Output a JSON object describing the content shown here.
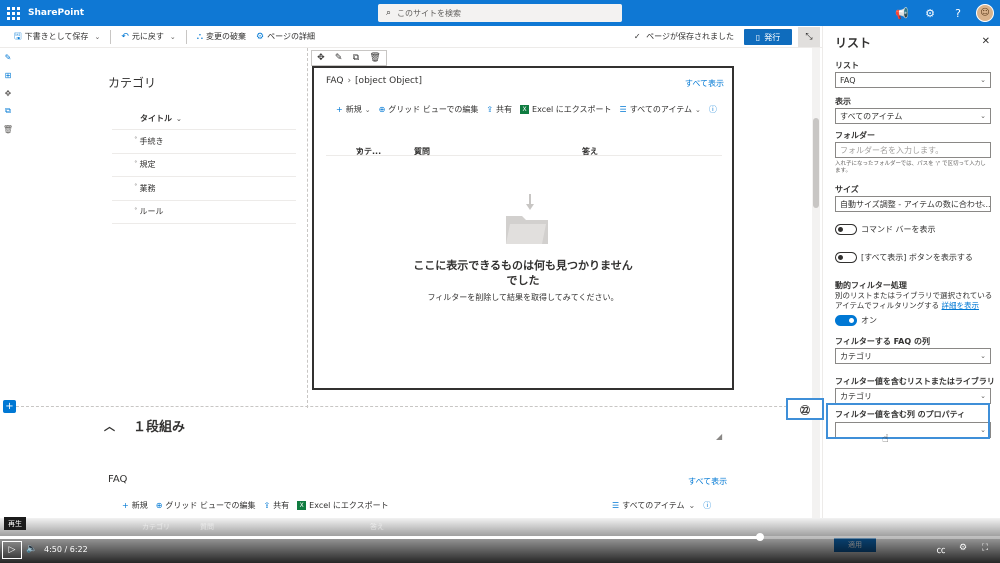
{
  "suite": {
    "brand": "SharePoint",
    "search_placeholder": "このサイトを検索",
    "avatar_initial": "☺"
  },
  "commandbar": {
    "save_draft": "下書きとして保存",
    "undo": "元に戻す",
    "discard": "変更の破棄",
    "page_details": "ページの詳細",
    "saved_status": "ページが保存されました",
    "publish": "発行"
  },
  "category_webpart": {
    "title": "カテゴリ",
    "column_header": "タイトル",
    "rows": [
      "手続き",
      "規定",
      "業務",
      "ルール"
    ]
  },
  "faq_webpart": {
    "list_name": "FAQ",
    "view_name": "[object Object]",
    "show_all": "すべて表示",
    "commands": {
      "new": "新規",
      "grid_edit": "グリッド ビューでの編集",
      "share": "共有",
      "export": "Excel にエクスポート",
      "all_items": "すべてのアイテム"
    },
    "columns": {
      "category": "カテ...",
      "question": "質問",
      "answer": "答え"
    },
    "empty_title": "ここに表示できるものは何も見つかりません\nでした",
    "empty_subtitle": "フィルターを削除して結果を取得してみてください。"
  },
  "section": {
    "title": "１段組み",
    "faq_title": "FAQ",
    "show_all": "すべて表示",
    "bottom_behind": [
      "カテゴリ",
      "質問",
      "答え"
    ]
  },
  "pane": {
    "title": "リスト",
    "list_label": "リスト",
    "list_value": "FAQ",
    "view_label": "表示",
    "view_value": "すべてのアイテム",
    "folder_label": "フォルダー",
    "folder_placeholder": "フォルダー名を入力します。",
    "folder_hint": "入れ子になったフォルダーでは、パスを '/' で区切って入力します。",
    "size_label": "サイズ",
    "size_value": "自動サイズ調整 - アイテムの数に合わせ...",
    "toggle_command_bar": "コマンド バーを表示",
    "toggle_show_all": "[すべて表示] ボタンを表示する",
    "dynamic_filter_label": "動的フィルター処理",
    "dynamic_filter_desc": "別のリストまたはライブラリで選択されているアイテムでフィルタリングする",
    "learn_more": "詳細を表示",
    "toggle_on_label": "オン",
    "filter_column_label": "フィルターする FAQ の列",
    "filter_column_value": "カテゴリ",
    "source_list_label": "フィルター値を含むリストまたはライブラリ",
    "source_list_value": "カテゴリ",
    "property_label": "フィルター値を含む列 のプロパティ",
    "property_value": "",
    "apply": "適用"
  },
  "annotation": {
    "step": "㉒"
  },
  "player": {
    "tooltip": "再生",
    "time": "4:50 / 6:22",
    "progress": 0.76
  },
  "colors": {
    "suitebar": "#0f78d4",
    "accent": "#0078d4",
    "highlight": "#3f8fd8"
  }
}
